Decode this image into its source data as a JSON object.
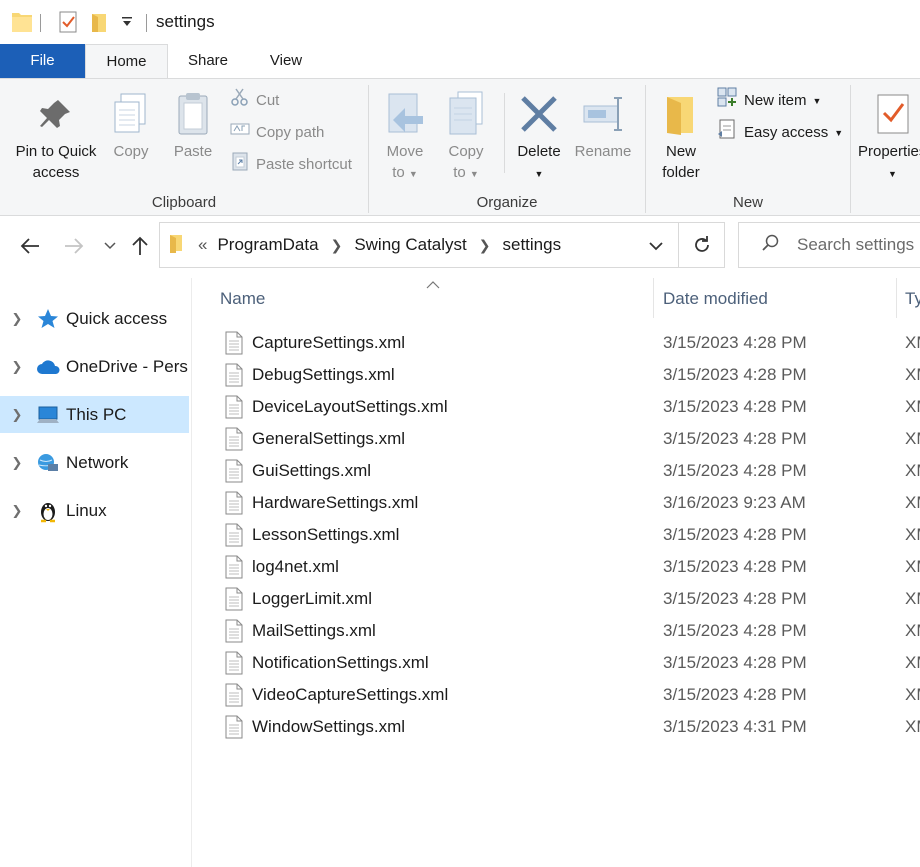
{
  "window": {
    "title": "settings"
  },
  "ribbon": {
    "tabs": [
      "File",
      "Home",
      "Share",
      "View"
    ],
    "clipboard": {
      "group_label": "Clipboard",
      "pin_label_1": "Pin to Quick",
      "pin_label_2": "access",
      "copy_label": "Copy",
      "paste_label": "Paste",
      "cut_label": "Cut",
      "copy_path_label": "Copy path",
      "paste_shortcut_label": "Paste shortcut"
    },
    "organize": {
      "group_label": "Organize",
      "move_label_1": "Move",
      "move_label_2": "to",
      "copy_label_1": "Copy",
      "copy_label_2": "to",
      "delete_label": "Delete",
      "rename_label": "Rename"
    },
    "new": {
      "group_label": "New",
      "new_folder_label_1": "New",
      "new_folder_label_2": "folder",
      "new_item_label": "New item",
      "easy_access_label": "Easy access"
    },
    "open": {
      "properties_label": "Properties"
    }
  },
  "address": {
    "overflow": "«",
    "crumbs": [
      "ProgramData",
      "Swing Catalyst",
      "settings"
    ],
    "search_placeholder": "Search settings"
  },
  "nav_pane": {
    "items": [
      {
        "label": "Quick access",
        "icon": "star-icon"
      },
      {
        "label": "OneDrive - Pers",
        "icon": "cloud-icon"
      },
      {
        "label": "This PC",
        "icon": "computer-icon",
        "selected": true
      },
      {
        "label": "Network",
        "icon": "network-icon"
      },
      {
        "label": "Linux",
        "icon": "penguin-icon"
      }
    ]
  },
  "file_list": {
    "columns": {
      "name": "Name",
      "date": "Date modified",
      "type": "Ty"
    },
    "files": [
      {
        "name": "CaptureSettings.xml",
        "date": "3/15/2023 4:28 PM",
        "type": "XML"
      },
      {
        "name": "DebugSettings.xml",
        "date": "3/15/2023 4:28 PM",
        "type": "XML"
      },
      {
        "name": "DeviceLayoutSettings.xml",
        "date": "3/15/2023 4:28 PM",
        "type": "XML"
      },
      {
        "name": "GeneralSettings.xml",
        "date": "3/15/2023 4:28 PM",
        "type": "XML"
      },
      {
        "name": "GuiSettings.xml",
        "date": "3/15/2023 4:28 PM",
        "type": "XML"
      },
      {
        "name": "HardwareSettings.xml",
        "date": "3/16/2023 9:23 AM",
        "type": "XML"
      },
      {
        "name": "LessonSettings.xml",
        "date": "3/15/2023 4:28 PM",
        "type": "XML"
      },
      {
        "name": "log4net.xml",
        "date": "3/15/2023 4:28 PM",
        "type": "XML"
      },
      {
        "name": "LoggerLimit.xml",
        "date": "3/15/2023 4:28 PM",
        "type": "XML"
      },
      {
        "name": "MailSettings.xml",
        "date": "3/15/2023 4:28 PM",
        "type": "XML"
      },
      {
        "name": "NotificationSettings.xml",
        "date": "3/15/2023 4:28 PM",
        "type": "XML"
      },
      {
        "name": "VideoCaptureSettings.xml",
        "date": "3/15/2023 4:28 PM",
        "type": "XML"
      },
      {
        "name": "WindowSettings.xml",
        "date": "3/15/2023 4:31 PM",
        "type": "XML"
      }
    ]
  },
  "colors": {
    "file_tab": "#1c5fb7",
    "selection": "#cce8ff",
    "column_header": "#4c607a"
  }
}
